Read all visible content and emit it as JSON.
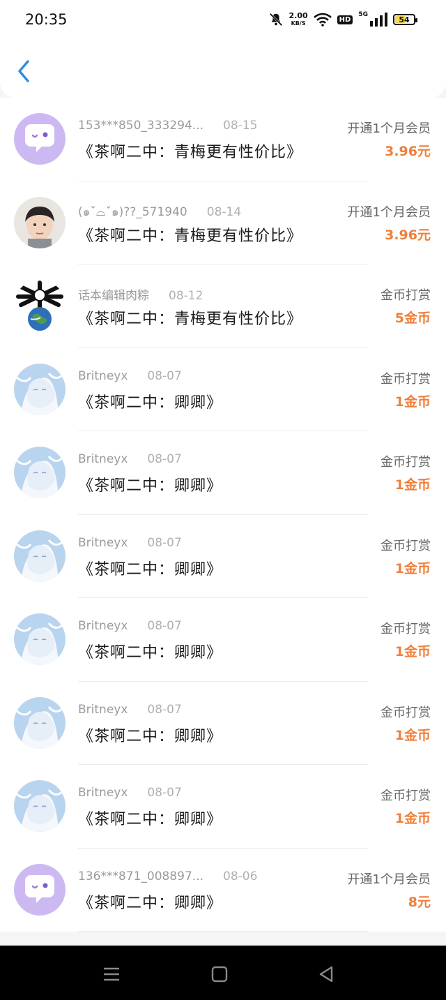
{
  "status_bar": {
    "time": "20:35",
    "speed_value": "2.00",
    "speed_unit": "KB/S",
    "hd": "HD",
    "network": "5G",
    "battery": "54"
  },
  "header": {
    "back_icon": "chevron-left-icon"
  },
  "items": [
    {
      "avatar": "chat-bubble-avatar",
      "name": "153***850_333294...",
      "date": "08-15",
      "title": "《茶啊二中：青梅更有性价比》",
      "type": "开通1个月会员",
      "amount": "3.96元"
    },
    {
      "avatar": "child-photo-avatar",
      "name": "(๑ˇ̀⌓ˇ́๑)??_571940",
      "date": "08-14",
      "title": "《茶啊二中：青梅更有性价比》",
      "type": "开通1个月会员",
      "amount": "3.96元"
    },
    {
      "avatar": "earth-bones-avatar",
      "name": "话本编辑肉粽",
      "date": "08-12",
      "title": "《茶啊二中：青梅更有性价比》",
      "type": "金币打赏",
      "amount": "5金币"
    },
    {
      "avatar": "anime-girl-avatar",
      "name": "Britneyx",
      "date": "08-07",
      "title": "《茶啊二中：卿卿》",
      "type": "金币打赏",
      "amount": "1金币"
    },
    {
      "avatar": "anime-girl-avatar",
      "name": "Britneyx",
      "date": "08-07",
      "title": "《茶啊二中：卿卿》",
      "type": "金币打赏",
      "amount": "1金币"
    },
    {
      "avatar": "anime-girl-avatar",
      "name": "Britneyx",
      "date": "08-07",
      "title": "《茶啊二中：卿卿》",
      "type": "金币打赏",
      "amount": "1金币"
    },
    {
      "avatar": "anime-girl-avatar",
      "name": "Britneyx",
      "date": "08-07",
      "title": "《茶啊二中：卿卿》",
      "type": "金币打赏",
      "amount": "1金币"
    },
    {
      "avatar": "anime-girl-avatar",
      "name": "Britneyx",
      "date": "08-07",
      "title": "《茶啊二中：卿卿》",
      "type": "金币打赏",
      "amount": "1金币"
    },
    {
      "avatar": "anime-girl-avatar",
      "name": "Britneyx",
      "date": "08-07",
      "title": "《茶啊二中：卿卿》",
      "type": "金币打赏",
      "amount": "1金币"
    },
    {
      "avatar": "chat-bubble-avatar",
      "name": "136***871_008897...",
      "date": "08-06",
      "title": "《茶啊二中：卿卿》",
      "type": "开通1个月会员",
      "amount": "8元"
    }
  ],
  "colors": {
    "accent_blue": "#2f8ddb",
    "amount_orange": "#f07f3a",
    "chat_avatar_bg": "#cdb9f2"
  },
  "nav": {
    "menu_icon": "menu-icon",
    "home_icon": "home-square-icon",
    "back_icon": "back-triangle-icon"
  }
}
